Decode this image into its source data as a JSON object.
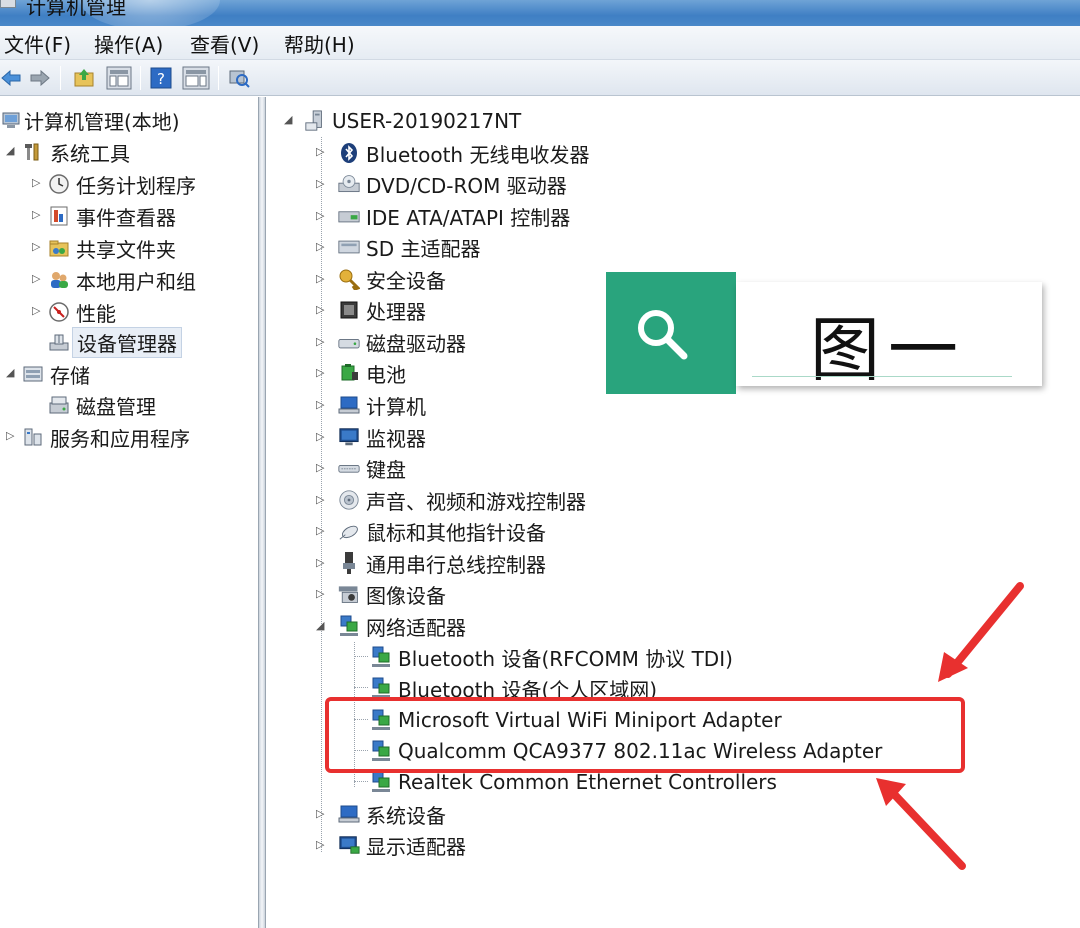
{
  "window": {
    "title": "计算机管理"
  },
  "menu": [
    {
      "label": "文件(F)"
    },
    {
      "label": "操作(A)"
    },
    {
      "label": "查看(V)"
    },
    {
      "label": "帮助(H)"
    }
  ],
  "left_tree": {
    "root": "计算机管理(本地)",
    "system_tools": "系统工具",
    "task_scheduler": "任务计划程序",
    "event_viewer": "事件查看器",
    "shared_folders": "共享文件夹",
    "local_users": "本地用户和组",
    "performance": "性能",
    "device_manager": "设备管理器",
    "storage": "存储",
    "disk_management": "磁盘管理",
    "services_apps": "服务和应用程序"
  },
  "device_tree": {
    "computer_name": "USER-20190217NT",
    "categories": [
      {
        "label": "Bluetooth 无线电收发器",
        "icon": "bluetooth-icon"
      },
      {
        "label": "DVD/CD-ROM 驱动器",
        "icon": "dvd-drive-icon"
      },
      {
        "label": "IDE ATA/ATAPI 控制器",
        "icon": "ide-controller-icon"
      },
      {
        "label": "SD 主适配器",
        "icon": "sd-adapter-icon"
      },
      {
        "label": "安全设备",
        "icon": "security-device-icon"
      },
      {
        "label": "处理器",
        "icon": "processor-icon"
      },
      {
        "label": "磁盘驱动器",
        "icon": "disk-drive-icon"
      },
      {
        "label": "电池",
        "icon": "battery-icon"
      },
      {
        "label": "计算机",
        "icon": "computer-icon"
      },
      {
        "label": "监视器",
        "icon": "monitor-icon"
      },
      {
        "label": "键盘",
        "icon": "keyboard-icon"
      },
      {
        "label": "声音、视频和游戏控制器",
        "icon": "sound-icon"
      },
      {
        "label": "鼠标和其他指针设备",
        "icon": "mouse-icon"
      },
      {
        "label": "通用串行总线控制器",
        "icon": "usb-icon"
      },
      {
        "label": "图像设备",
        "icon": "camera-icon"
      },
      {
        "label": "网络适配器",
        "icon": "network-adapter-icon"
      }
    ],
    "network_adapters": [
      {
        "label": "Bluetooth 设备(RFCOMM 协议 TDI)"
      },
      {
        "label": "Bluetooth 设备(个人区域网)"
      },
      {
        "label": "Microsoft Virtual WiFi Miniport Adapter"
      },
      {
        "label": "Qualcomm QCA9377 802.11ac Wireless Adapter"
      },
      {
        "label": "Realtek Common Ethernet Controllers"
      }
    ],
    "after": [
      {
        "label": "系统设备",
        "icon": "system-device-icon"
      },
      {
        "label": "显示适配器",
        "icon": "display-adapter-icon"
      }
    ]
  },
  "overlay": {
    "search_label": "图一"
  },
  "colors": {
    "accent_green": "#29a47d",
    "annotation_red": "#e8302f"
  }
}
